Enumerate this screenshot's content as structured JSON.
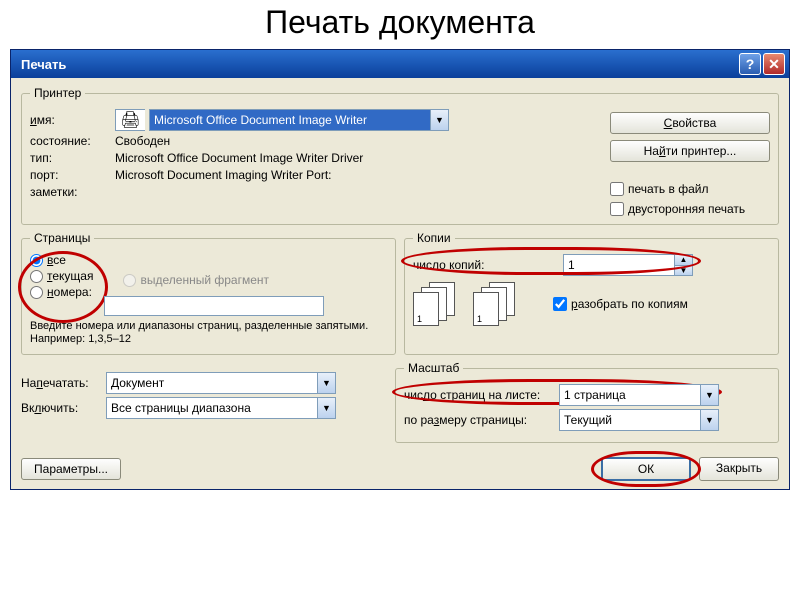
{
  "slide_title": "Печать документа",
  "title": "Печать",
  "printer": {
    "legend": "Принтер",
    "name_label": "имя:",
    "name_value": "Microsoft Office Document Image Writer",
    "status_label": "состояние:",
    "status_value": "Свободен",
    "type_label": "тип:",
    "type_value": "Microsoft Office Document Image Writer Driver",
    "port_label": "порт:",
    "port_value": "Microsoft Document Imaging Writer Port:",
    "notes_label": "заметки:",
    "properties_btn": "Свойства",
    "find_btn": "Найти принтер...",
    "to_file": "печать в файл",
    "duplex": "двусторонняя печать"
  },
  "pages": {
    "legend": "Страницы",
    "all": "все",
    "current": "текущая",
    "selection": "выделенный фрагмент",
    "numbers": "номера:",
    "hint": "Введите номера или диапазоны страниц, разделенные запятыми. Например: 1,3,5–12"
  },
  "copies": {
    "legend": "Копии",
    "count_label": "число копий:",
    "count_value": "1",
    "collate": "разобрать по копиям"
  },
  "what": {
    "print_label": "Напечатать:",
    "print_value": "Документ",
    "include_label": "Включить:",
    "include_value": "Все страницы диапазона"
  },
  "scale": {
    "legend": "Масштаб",
    "per_sheet_label": "число страниц на листе:",
    "per_sheet_value": "1 страница",
    "fit_label": "по размеру страницы:",
    "fit_value": "Текущий"
  },
  "footer": {
    "options": "Параметры...",
    "ok": "ОК",
    "close": "Закрыть"
  }
}
